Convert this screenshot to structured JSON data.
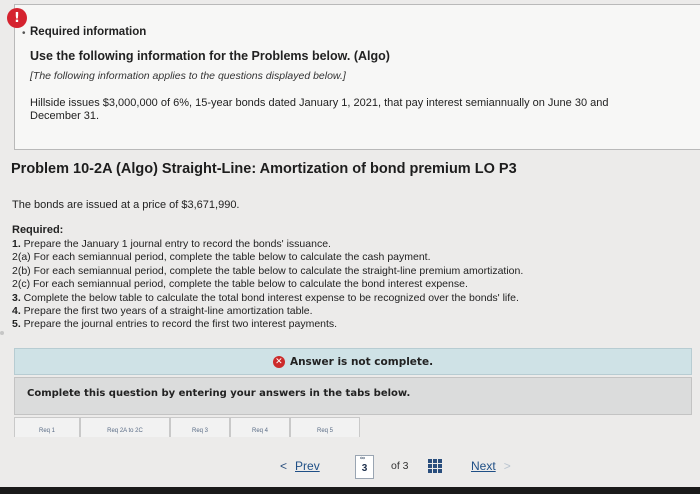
{
  "info": {
    "title": "Required information",
    "use_line": "Use the following information for the Problems below. (Algo)",
    "note": "[The following information applies to the questions displayed below.]",
    "body": "Hillside issues $3,000,000 of 6%, 15-year bonds dated January 1, 2021, that pay interest semiannually on June 30 and December 31."
  },
  "problem": {
    "title": "Problem 10-2A (Algo) Straight-Line: Amortization of bond premium LO P3",
    "issued": "The bonds are issued at a price of $3,671,990.",
    "required_label": "Required:",
    "requirements": [
      {
        "num": "1.",
        "text": " Prepare the January 1 journal entry to record the bonds' issuance."
      },
      {
        "num": "2(a)",
        "text": " For each semiannual period, complete the table below to calculate the cash payment."
      },
      {
        "num": "2(b)",
        "text": " For each semiannual period, complete the table below to calculate the straight-line premium amortization."
      },
      {
        "num": "2(c)",
        "text": " For each semiannual period, complete the table below to calculate the bond interest expense."
      },
      {
        "num": "3.",
        "text": " Complete the below table to calculate the total bond interest expense to be recognized over the bonds' life."
      },
      {
        "num": "4.",
        "text": " Prepare the first two years of a straight-line amortization table."
      },
      {
        "num": "5.",
        "text": " Prepare the journal entries to record the first two interest payments."
      }
    ]
  },
  "status": {
    "answer": "Answer is not complete.",
    "instruction": "Complete this question by entering your answers in the tabs below."
  },
  "tabs": [
    "Req 1",
    "Req 2A to 2C",
    "Req 3",
    "Req 4",
    "Req 5"
  ],
  "pager": {
    "prev": "Prev",
    "current": "3",
    "of": "of 3",
    "next": "Next"
  },
  "colors": {
    "alert": "#d5232f",
    "answer_bar": "#cfe2e6",
    "link": "#1f4f86"
  }
}
